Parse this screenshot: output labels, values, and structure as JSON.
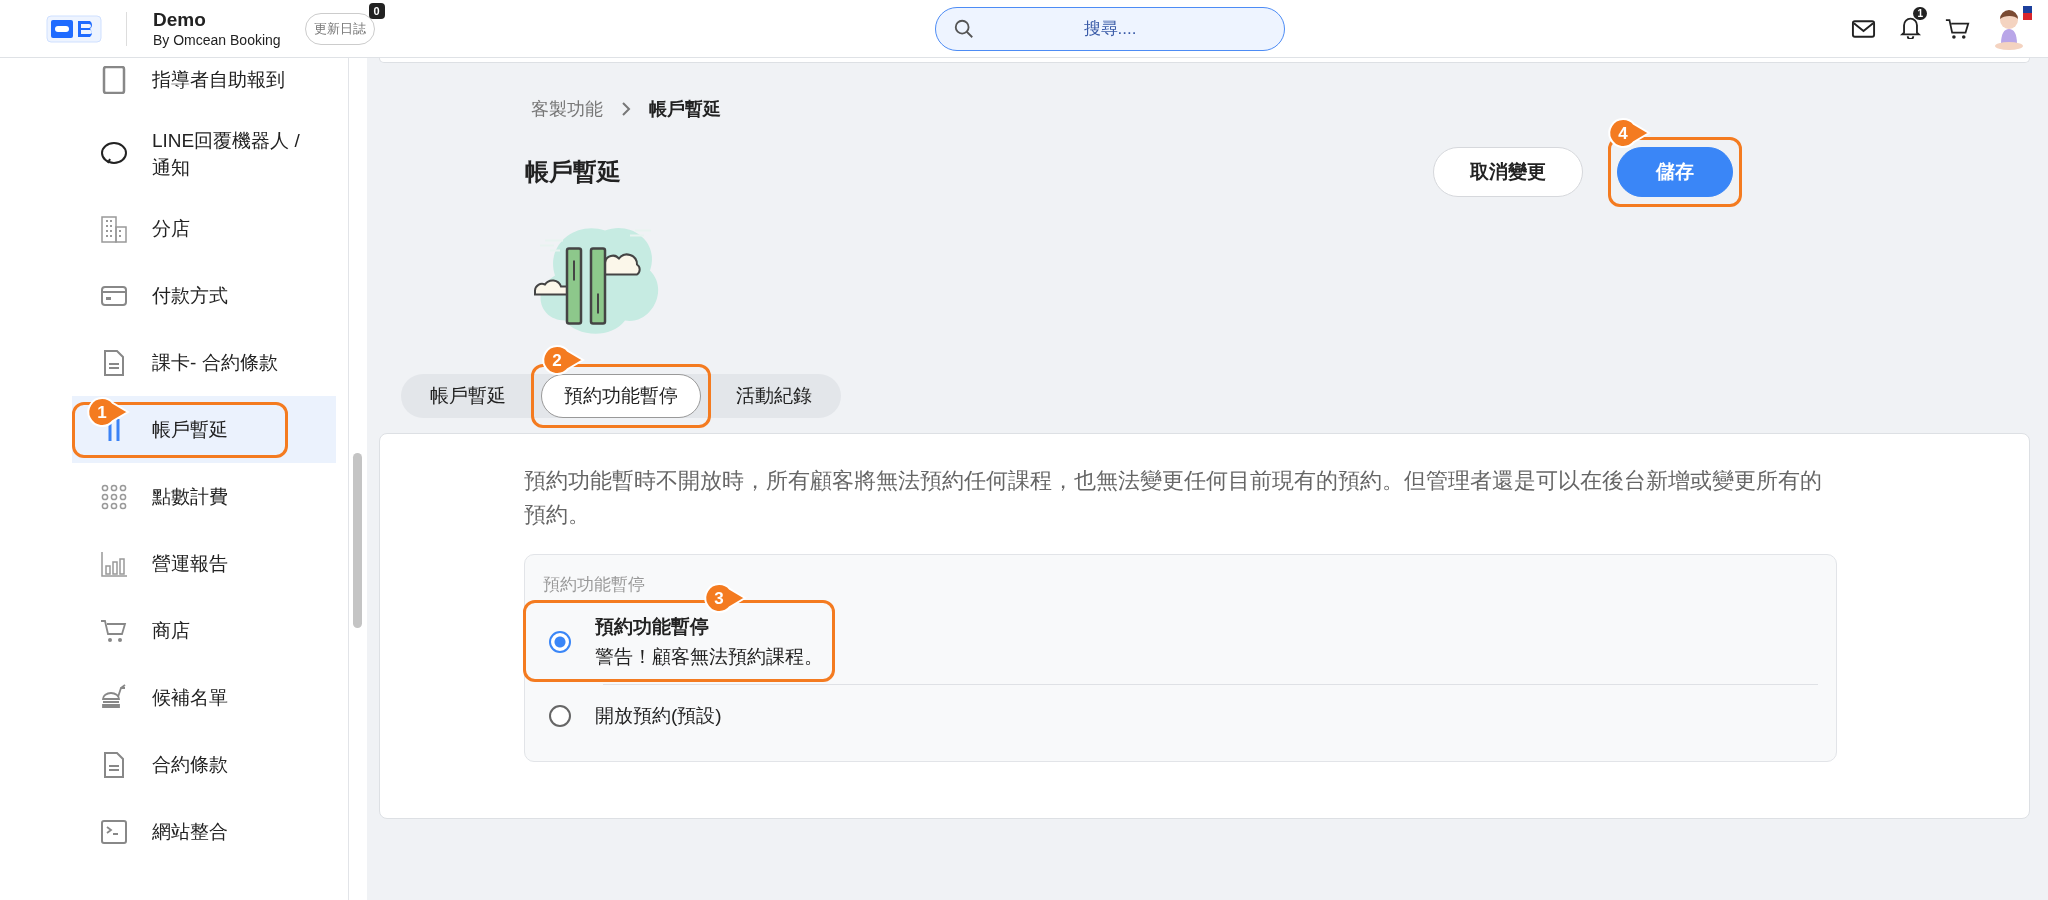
{
  "header": {
    "app_name": "Demo",
    "subtitle": "By Omcean Booking",
    "changelog_button": "更新日誌",
    "changelog_count": "0",
    "search": {
      "placeholder": "搜尋...."
    },
    "notification_count": "1"
  },
  "sidebar": {
    "items": [
      {
        "label": "指導者自助報到",
        "selected": false
      },
      {
        "label": "LINE回覆機器人 / 通知",
        "selected": false
      },
      {
        "label": "分店",
        "selected": false
      },
      {
        "label": "付款方式",
        "selected": false
      },
      {
        "label": "課卡- 合約條款",
        "selected": false
      },
      {
        "label": "帳戶暫延",
        "selected": true,
        "callout": "1"
      },
      {
        "label": "點數計費",
        "selected": false
      },
      {
        "label": "營運報告",
        "selected": false
      },
      {
        "label": "商店",
        "selected": false
      },
      {
        "label": "候補名單",
        "selected": false
      },
      {
        "label": "合約條款",
        "selected": false
      },
      {
        "label": "網站整合",
        "selected": false
      }
    ]
  },
  "breadcrumb": [
    "客製功能",
    "帳戶暫延"
  ],
  "page_title": "帳戶暫延",
  "buttons": [
    {
      "label": "取消變更",
      "kind": "secondary"
    },
    {
      "label": "儲存",
      "kind": "primary",
      "callout": "4"
    }
  ],
  "tabs": [
    {
      "label": "帳戶暫延",
      "selected": false
    },
    {
      "label": "預約功能暫停",
      "selected": true,
      "callout": "2"
    },
    {
      "label": "活動紀錄",
      "selected": false
    }
  ],
  "description": "預約功能暫時不開放時，所有顧客將無法預約任何課程，也無法變更任何目前現有的預約。但管理者還是可以在後台新增或變更所有的預約。",
  "radio_group": {
    "label": "預約功能暫停",
    "options": [
      {
        "label": "預約功能暫停",
        "hint": "警告！顧客無法預約課程。",
        "selected": true,
        "callout": "3"
      },
      {
        "label": "開放預約(預設)",
        "selected": false
      }
    ]
  }
}
